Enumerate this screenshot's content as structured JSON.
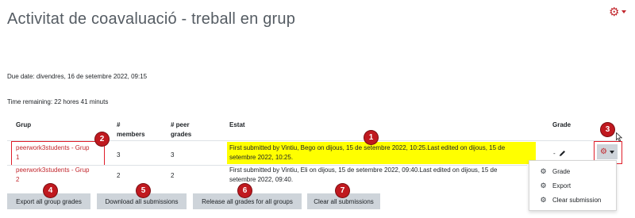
{
  "page": {
    "title": "Activitat de coavaluació - treball en grup",
    "top_menu_icon": "gear-icon",
    "due_date": "Due date: divendres, 16 de setembre 2022, 09:15",
    "time_remaining": "Time remaining: 22 hores 41 minuts"
  },
  "table": {
    "headers": {
      "group": "Grup",
      "members_1": "#",
      "members_2": "members",
      "peer_1": "# peer",
      "peer_2": "grades",
      "status": "Estat",
      "grade": "Grade"
    },
    "rows": [
      {
        "group_line1": "peerwork3students - Grup",
        "group_line2": "1",
        "members": "3",
        "peer_grades": "3",
        "status_line1": "First submitted by Vintiu, Bego on dijous, 15 de setembre 2022, 10:25.Last edited on dijous, 15 de",
        "status_line2": "setembre 2022, 10:25.",
        "grade": "-"
      },
      {
        "group_line1": "peerwork3students - Grup",
        "group_line2": "2",
        "members": "2",
        "peer_grades": "2",
        "status_line1": "First submitted by Vintiu, Eli on dijous, 15 de setembre 2022, 09:40.Last edited on dijous, 15 de",
        "status_line2": "setembre 2022, 09:40."
      }
    ]
  },
  "buttons": {
    "export": "Export all group grades",
    "download": "Download all submissions",
    "release": "Release all grades for all groups",
    "clear": "Clear all submissions"
  },
  "action_menu": {
    "items": [
      {
        "label": "Grade",
        "icon": "gear-icon"
      },
      {
        "label": "Export",
        "icon": "gear-icon"
      },
      {
        "label": "Clear submission",
        "icon": "gear-icon"
      }
    ]
  },
  "badges": [
    "1",
    "2",
    "3",
    "4",
    "5",
    "6",
    "7"
  ],
  "colors": {
    "accent": "#c2272d",
    "highlight": "#ffff00",
    "badge": "#c0191f",
    "button": "#ced4da"
  }
}
